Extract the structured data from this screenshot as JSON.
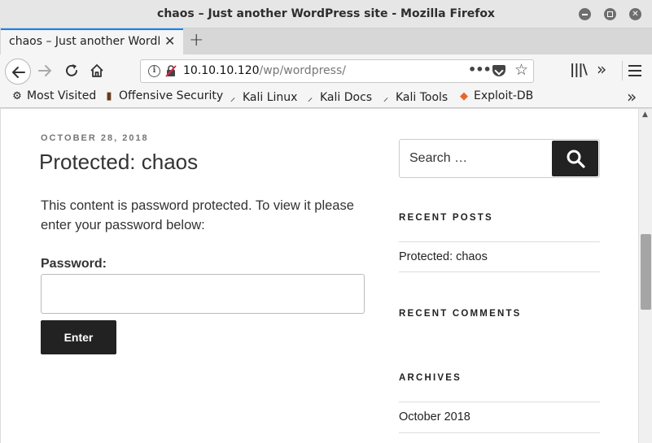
{
  "window": {
    "title": "chaos – Just another WordPress site - Mozilla Firefox"
  },
  "tabs": [
    {
      "title": "chaos – Just another WordPress site"
    }
  ],
  "toolbar": {
    "url_host": "10.10.10.120",
    "url_path": "/wp/wordpress/",
    "page_actions": "•••"
  },
  "bookmarks": [
    {
      "label": "Most Visited",
      "icon": "gear-icon"
    },
    {
      "label": "Offensive Security",
      "icon": "offsec-icon"
    },
    {
      "label": "Kali Linux",
      "icon": "kali-dragon-icon"
    },
    {
      "label": "Kali Docs",
      "icon": "kali-dragon-icon"
    },
    {
      "label": "Kali Tools",
      "icon": "kali-dragon-icon"
    },
    {
      "label": "Exploit-DB",
      "icon": "exploitdb-icon"
    }
  ],
  "post": {
    "date": "OCTOBER 28, 2018",
    "title": "Protected: chaos",
    "text": "This content is password protected. To view it please enter your password below:",
    "password_label": "Password:",
    "password_value": "",
    "enter_label": "Enter"
  },
  "sidebar": {
    "search_placeholder": "Search …",
    "recent_posts_title": "RECENT POSTS",
    "recent_posts": [
      "Protected: chaos"
    ],
    "recent_comments_title": "RECENT COMMENTS",
    "archives_title": "ARCHIVES",
    "archives": [
      "October 2018"
    ]
  },
  "colors": {
    "accent": "#0a84ff",
    "button_dark": "#222222"
  }
}
